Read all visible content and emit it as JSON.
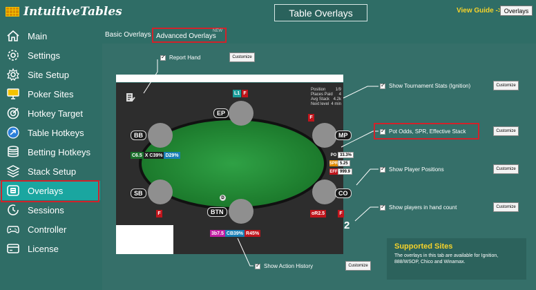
{
  "app": {
    "logo_text": "IntuitiveTables"
  },
  "header": {
    "title": "Table Overlays",
    "view_guide": "View Guide ->",
    "overlays_button": "Overlays"
  },
  "sidebar": {
    "items": [
      {
        "label": "Main",
        "icon": "home-icon"
      },
      {
        "label": "Settings",
        "icon": "gear-icon"
      },
      {
        "label": "Site Setup",
        "icon": "cog-icon"
      },
      {
        "label": "Poker Sites",
        "icon": "monitor-icon"
      },
      {
        "label": "Hotkey Target",
        "icon": "target-icon"
      },
      {
        "label": "Table Hotkeys",
        "icon": "arrow-circle-icon"
      },
      {
        "label": "Betting Hotkeys",
        "icon": "database-icon"
      },
      {
        "label": "Stack Setup",
        "icon": "layers-icon"
      },
      {
        "label": "Overlays",
        "icon": "overlay-icon"
      },
      {
        "label": "Sessions",
        "icon": "clock-icon"
      },
      {
        "label": "Controller",
        "icon": "gamepad-icon"
      },
      {
        "label": "License",
        "icon": "card-icon"
      }
    ],
    "active_index": 8
  },
  "tabs": {
    "basic": "Basic Overlays",
    "advanced": "Advanced Overlays",
    "new_badge": "NEW"
  },
  "options": {
    "report_hand": "Report Hand",
    "tournament_stats": "Show Tournament Stats (Ignition)",
    "pot_odds": "Pot Odds, SPR, Effective Stack",
    "player_positions": "Show Player Positions",
    "players_in_hand": "Show players in hand count",
    "action_history": "Show Action History",
    "customize": "Customize"
  },
  "table": {
    "positions": {
      "ep": "EP",
      "mp": "MP",
      "co": "CO",
      "btn": "BTN",
      "sb": "SB",
      "bb": "BB"
    },
    "flag_f": "F",
    "flag_l1": "L1",
    "dealer": "D",
    "bb_stats": [
      "C6.5",
      "X C39%",
      "D29%"
    ],
    "btn_stats": [
      "3b7.5",
      "CB39%",
      "R45%"
    ],
    "co_stat": "oR2.5",
    "tournament": [
      {
        "k": "Position",
        "v": "1/9"
      },
      {
        "k": "Places Paid",
        "v": "4"
      },
      {
        "k": "Avg Stack",
        "v": "4.2k"
      },
      {
        "k": "Next level",
        "v": "4 min"
      }
    ],
    "pot_odds": {
      "po_label": "PO",
      "po": "33.3%",
      "spr_label": "SPR",
      "spr": "5.25",
      "eff_label": "EFF",
      "eff": "999.9"
    },
    "players_count": "2"
  },
  "supported": {
    "title": "Supported Sites",
    "text": "The overlays in this tab are available for Ignition, 888/WSOP, Chico and Winamax."
  },
  "colors": {
    "accent": "#1aa6a0",
    "highlight": "#d2222a",
    "background": "#2f6d66",
    "gold": "#f6d32a"
  }
}
